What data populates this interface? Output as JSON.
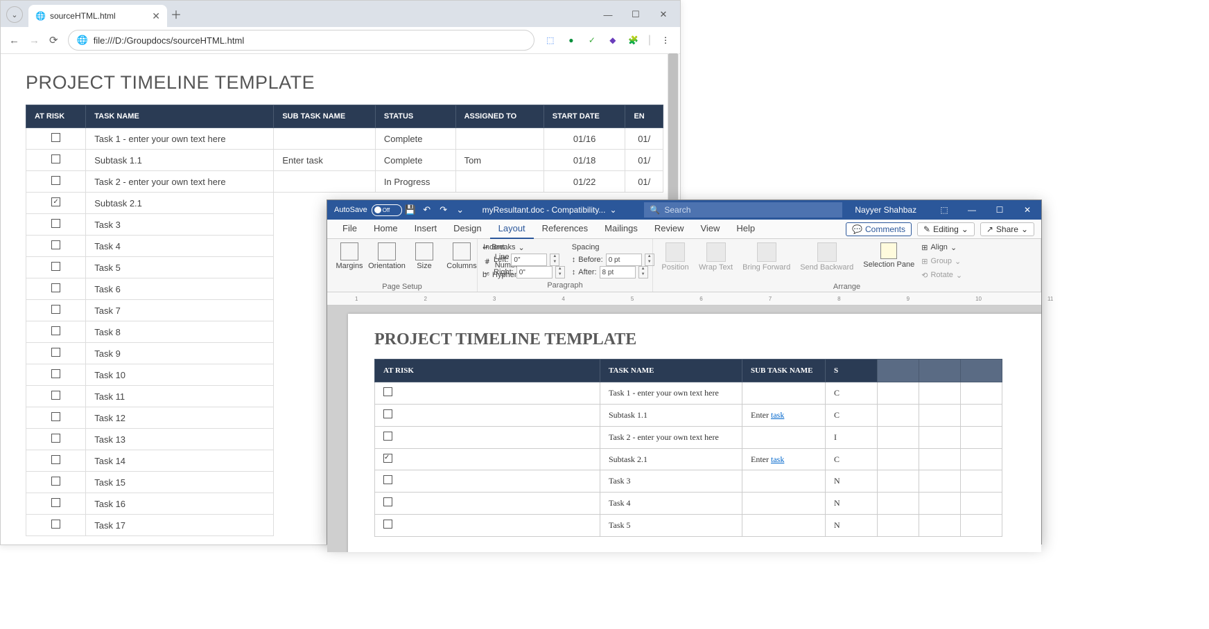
{
  "browser": {
    "tab_title": "sourceHTML.html",
    "address": "file:///D:/Groupdocs/sourceHTML.html",
    "page_heading": "PROJECT TIMELINE TEMPLATE",
    "columns": [
      "AT RISK",
      "TASK NAME",
      "SUB TASK NAME",
      "STATUS",
      "ASSIGNED TO",
      "START DATE",
      "EN"
    ],
    "rows": [
      {
        "chk": false,
        "task": "Task 1 - enter your own text here",
        "sub": "",
        "status": "Complete",
        "assigned": "",
        "start": "01/16",
        "end": "01/"
      },
      {
        "chk": false,
        "task": "Subtask 1.1",
        "sub": "Enter task",
        "status": "Complete",
        "assigned": "Tom",
        "start": "01/18",
        "end": "01/"
      },
      {
        "chk": false,
        "task": "Task 2 - enter your own text here",
        "sub": "",
        "status": "In Progress",
        "assigned": "",
        "start": "01/22",
        "end": "01/"
      },
      {
        "chk": true,
        "task": "Subtask 2.1",
        "sub": "",
        "status": "",
        "assigned": "",
        "start": "",
        "end": ""
      },
      {
        "chk": false,
        "task": "Task 3",
        "sub": "",
        "status": "",
        "assigned": "",
        "start": "",
        "end": ""
      },
      {
        "chk": false,
        "task": "Task 4",
        "sub": "",
        "status": "",
        "assigned": "",
        "start": "",
        "end": ""
      },
      {
        "chk": false,
        "task": "Task 5",
        "sub": "",
        "status": "",
        "assigned": "",
        "start": "",
        "end": ""
      },
      {
        "chk": false,
        "task": "Task 6",
        "sub": "",
        "status": "",
        "assigned": "",
        "start": "",
        "end": ""
      },
      {
        "chk": false,
        "task": "Task 7",
        "sub": "",
        "status": "",
        "assigned": "",
        "start": "",
        "end": ""
      },
      {
        "chk": false,
        "task": "Task 8",
        "sub": "",
        "status": "",
        "assigned": "",
        "start": "",
        "end": ""
      },
      {
        "chk": false,
        "task": "Task 9",
        "sub": "",
        "status": "",
        "assigned": "",
        "start": "",
        "end": ""
      },
      {
        "chk": false,
        "task": "Task 10",
        "sub": "",
        "status": "",
        "assigned": "",
        "start": "",
        "end": ""
      },
      {
        "chk": false,
        "task": "Task 11",
        "sub": "",
        "status": "",
        "assigned": "",
        "start": "",
        "end": ""
      },
      {
        "chk": false,
        "task": "Task 12",
        "sub": "",
        "status": "",
        "assigned": "",
        "start": "",
        "end": ""
      },
      {
        "chk": false,
        "task": "Task 13",
        "sub": "",
        "status": "",
        "assigned": "",
        "start": "",
        "end": ""
      },
      {
        "chk": false,
        "task": "Task 14",
        "sub": "",
        "status": "",
        "assigned": "",
        "start": "",
        "end": ""
      },
      {
        "chk": false,
        "task": "Task 15",
        "sub": "",
        "status": "",
        "assigned": "",
        "start": "",
        "end": ""
      },
      {
        "chk": false,
        "task": "Task 16",
        "sub": "",
        "status": "",
        "assigned": "",
        "start": "",
        "end": ""
      },
      {
        "chk": false,
        "task": "Task 17",
        "sub": "",
        "status": "",
        "assigned": "",
        "start": "",
        "end": ""
      }
    ]
  },
  "word": {
    "autosave_label": "AutoSave",
    "autosave_state": "Off",
    "doc_title": "myResultant.doc - Compatibility...",
    "search_placeholder": "Search",
    "user": "Nayyer Shahbaz",
    "tabs": [
      "File",
      "Home",
      "Insert",
      "Design",
      "Layout",
      "References",
      "Mailings",
      "Review",
      "View",
      "Help"
    ],
    "active_tab": "Layout",
    "comments_btn": "Comments",
    "editing_btn": "Editing",
    "share_btn": "Share",
    "ribbon": {
      "page_setup": {
        "label": "Page Setup",
        "margins": "Margins",
        "orientation": "Orientation",
        "size": "Size",
        "columns": "Columns",
        "breaks": "Breaks",
        "line_numbers": "Line Numbers",
        "hyphenation": "Hyphenation"
      },
      "paragraph": {
        "label": "Paragraph",
        "indent": "Indent",
        "left": "Left:",
        "right": "Right:",
        "left_val": "0\"",
        "right_val": "0\"",
        "spacing": "Spacing",
        "before": "Before:",
        "after": "After:",
        "before_val": "0 pt",
        "after_val": "8 pt"
      },
      "arrange": {
        "label": "Arrange",
        "position": "Position",
        "wrap": "Wrap Text",
        "forward": "Bring Forward",
        "backward": "Send Backward",
        "selection": "Selection Pane",
        "align": "Align",
        "group": "Group",
        "rotate": "Rotate"
      }
    },
    "page_heading": "PROJECT TIMELINE TEMPLATE",
    "columns": [
      "AT RISK",
      "TASK NAME",
      "SUB TASK NAME",
      "S"
    ],
    "rows": [
      {
        "chk": false,
        "task": "Task 1 - enter your own text here",
        "sub": "",
        "s": "C"
      },
      {
        "chk": false,
        "task": "Subtask 1.1",
        "sub": "Enter task",
        "s": "C",
        "link": true
      },
      {
        "chk": false,
        "task": "Task 2 - enter your own text here",
        "sub": "",
        "s": "I"
      },
      {
        "chk": true,
        "task": "Subtask 2.1",
        "sub": "Enter task",
        "s": "C",
        "link": true
      },
      {
        "chk": false,
        "task": "Task 3",
        "sub": "",
        "s": "N"
      },
      {
        "chk": false,
        "task": "Task 4",
        "sub": "",
        "s": "N"
      },
      {
        "chk": false,
        "task": "Task 5",
        "sub": "",
        "s": "N"
      }
    ]
  }
}
